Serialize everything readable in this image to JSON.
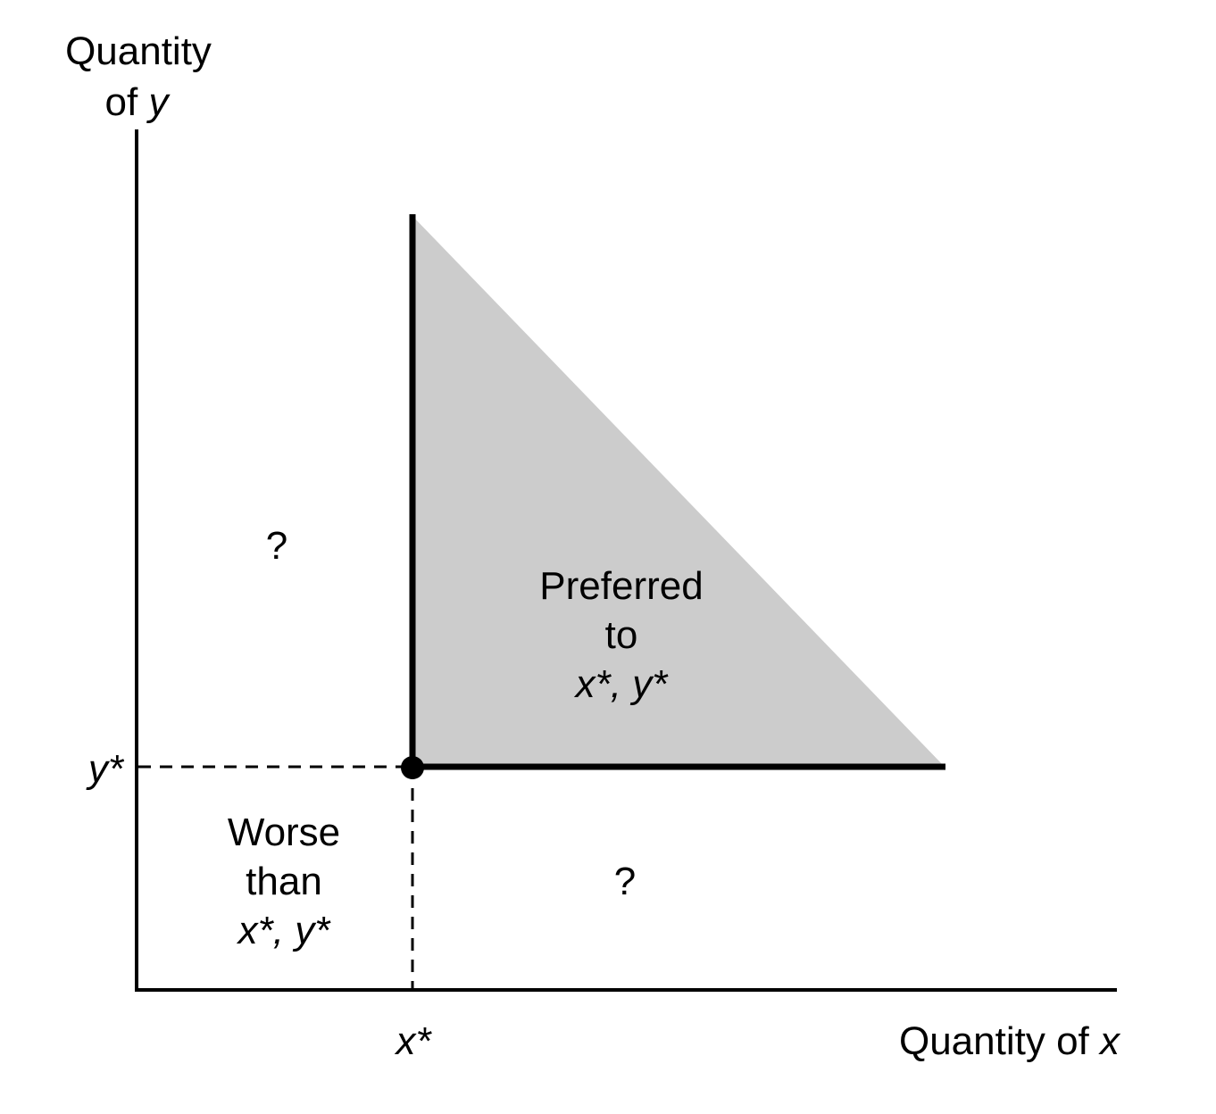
{
  "axes": {
    "y_label_line1": "Quantity",
    "y_label_line2_prefix": "of ",
    "y_label_line2_var": "y",
    "x_label_prefix": "Quantity of ",
    "x_label_var": "x"
  },
  "ticks": {
    "x_star": "x*",
    "y_star": "y*"
  },
  "regions": {
    "preferred": {
      "line1": "Preferred",
      "line2": "to",
      "line3": "x*, y*"
    },
    "worse": {
      "line1": "Worse",
      "line2": "than",
      "line3": "x*, y*"
    },
    "upper_left_question": "?",
    "lower_right_question": "?"
  },
  "colors": {
    "axis": "#000000",
    "preferred_fill": "#cccccc",
    "point": "#000000"
  }
}
